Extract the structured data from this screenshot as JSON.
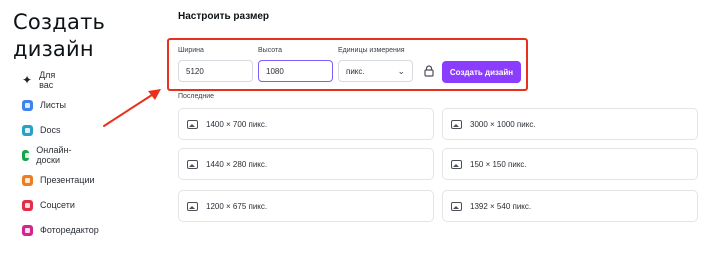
{
  "header": {
    "title": "Создать дизайн"
  },
  "sidebar": {
    "items": [
      {
        "label": "Для вас",
        "icon": "sparkle-icon"
      },
      {
        "label": "Листы",
        "icon": "sheets-icon"
      },
      {
        "label": "Docs",
        "icon": "docs-icon"
      },
      {
        "label": "Онлайн-доски",
        "icon": "whiteboard-icon"
      },
      {
        "label": "Презентации",
        "icon": "presentation-icon"
      },
      {
        "label": "Соцсети",
        "icon": "social-icon"
      },
      {
        "label": "Фоторедактор",
        "icon": "photo-editor-icon"
      }
    ]
  },
  "custom_size": {
    "title": "Настроить размер",
    "width_label": "Ширина",
    "width_value": "5120",
    "height_label": "Высота",
    "height_value": "1080",
    "units_label": "Единицы измерения",
    "units_value": "пикс.",
    "create_button": "Создать дизайн",
    "highlight_color": "#e8311d",
    "accent_color": "#8b3dff"
  },
  "recent": {
    "label": "Последние",
    "items": [
      {
        "text": "1400 × 700 пикс."
      },
      {
        "text": "3000 × 1000 пикс."
      },
      {
        "text": "1440 × 280 пикс."
      },
      {
        "text": "150 × 150 пикс."
      },
      {
        "text": "1200 × 675 пикс."
      },
      {
        "text": "1392 × 540 пикс."
      }
    ]
  }
}
